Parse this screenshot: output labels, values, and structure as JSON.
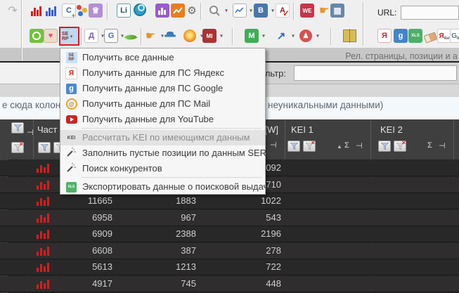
{
  "glyphs": {
    "redo": "↷",
    "serp_top": "SE",
    "serp_bottom": "RP",
    "letter_c": "C",
    "li": "Li",
    "letter_b": "B",
    "letter_a": "A",
    "check": "✓",
    "we": "WE",
    "letter_d": "Д",
    "letter_g": "G",
    "mi": "MI",
    "letter_m": "M",
    "arrow_up_right": "↗",
    "person": "♟",
    "hand": "☛",
    "crown": "♕",
    "wrench": "⚙",
    "grid": "▦",
    "heart": "♥",
    "yandex": "Я",
    "google_g": "g",
    "xls": "XLS",
    "kei": "KEI",
    "at": "@",
    "rel": "Rel",
    "sigma": "Σ",
    "pin": "⊣",
    "sort_asc": "▲"
  },
  "toolbar": {
    "url_label": "URL:"
  },
  "filter_bar": {
    "label": "Фильтр:",
    "value": ""
  },
  "right_panel": {
    "header": "Рел. страницы, позиции и а"
  },
  "group_hint": {
    "left_fragment": "е сюда колон",
    "right_fragment": "неуникальными данными)"
  },
  "menu": {
    "items": [
      {
        "icon": "serp-icon",
        "label": "Получить все данные"
      },
      {
        "icon": "yandex-icon",
        "label": "Получить данные для ПС Яндекс"
      },
      {
        "icon": "google-icon",
        "label": "Получить данные для ПС Google"
      },
      {
        "icon": "mail-icon",
        "label": "Получить данные для ПС Mail"
      },
      {
        "icon": "youtube-icon",
        "label": "Получить данные для YouTube"
      },
      {
        "icon": "kei-icon",
        "label": "Рассчитать KEI по имеющимся данным",
        "state": "hovered-disabled"
      },
      {
        "icon": "wand-icon",
        "label": "Заполнить пустые позиции по данным SERP"
      },
      {
        "icon": "wand-icon",
        "label": "Поиск конкурентов"
      },
      {
        "icon": "excel-icon",
        "label": "Экспортировать данные о поисковой выдаче"
      }
    ]
  },
  "table": {
    "headers": {
      "freq": "Част",
      "w": "[W]",
      "kei1": "KEI 1",
      "kei2": "KEI 2"
    },
    "rows": [
      {
        "n1": "",
        "n2": "",
        "n3": "092"
      },
      {
        "n1": "",
        "n2": "",
        "n3": "710"
      },
      {
        "n1": "11665",
        "n2": "1883",
        "n3": "1022"
      },
      {
        "n1": "6958",
        "n2": "967",
        "n3": "543"
      },
      {
        "n1": "6909",
        "n2": "2388",
        "n3": "2196"
      },
      {
        "n1": "6608",
        "n2": "387",
        "n3": "278"
      },
      {
        "n1": "5613",
        "n2": "1213",
        "n3": "722"
      },
      {
        "n1": "4917",
        "n2": "745",
        "n3": "448"
      }
    ]
  }
}
